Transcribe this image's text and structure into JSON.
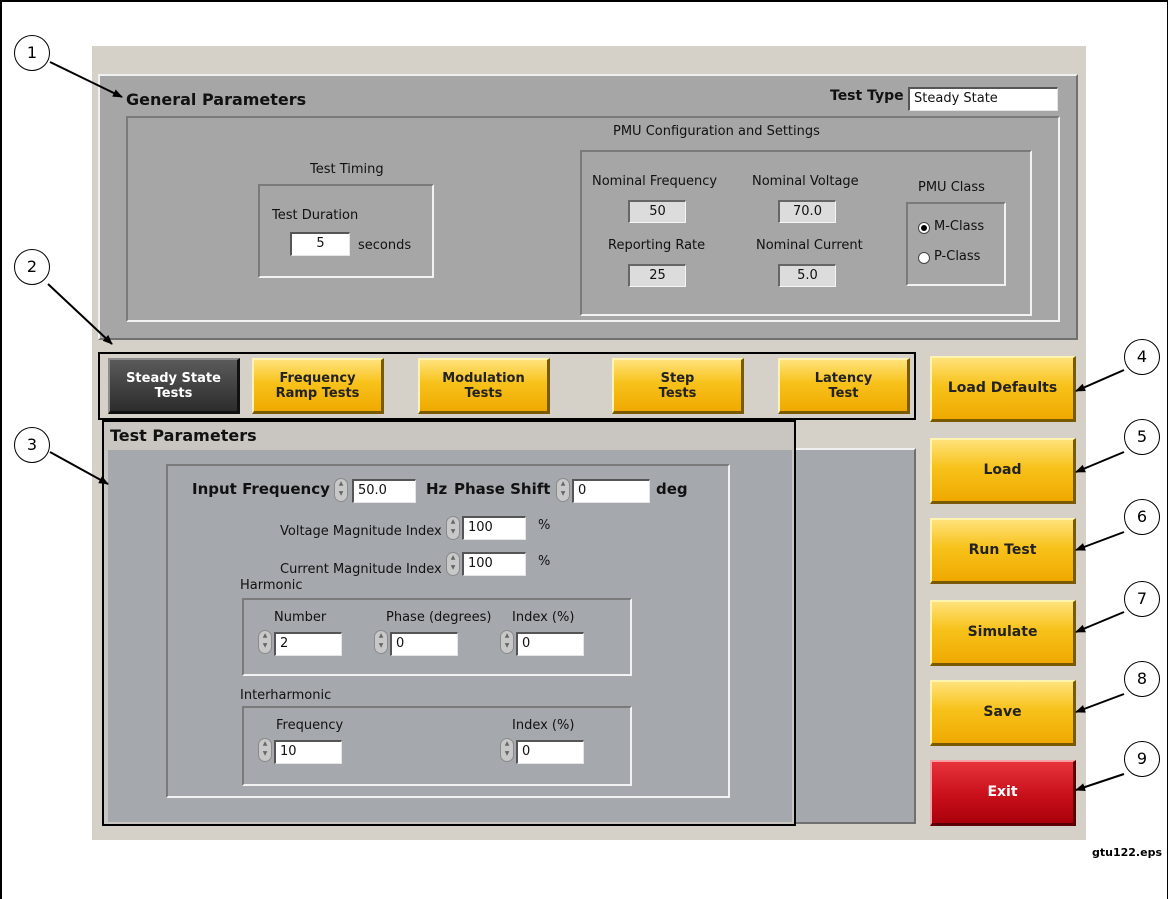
{
  "general": {
    "title": "General Parameters",
    "test_type_label": "Test Type",
    "test_type_value": "Steady State",
    "pmu_title": "PMU Configuration and Settings",
    "timing": {
      "title": "Test Timing",
      "duration_label": "Test Duration",
      "duration_value": "5",
      "duration_unit": "seconds"
    },
    "nominal_frequency": {
      "label": "Nominal Frequency",
      "value": "50"
    },
    "nominal_voltage": {
      "label": "Nominal Voltage",
      "value": "70.0"
    },
    "reporting_rate": {
      "label": "Reporting Rate",
      "value": "25"
    },
    "nominal_current": {
      "label": "Nominal Current",
      "value": "5.0"
    },
    "pmu_class": {
      "title": "PMU Class",
      "options": [
        "M-Class",
        "P-Class"
      ],
      "selected": "M-Class"
    }
  },
  "tabs": [
    {
      "line1": "Steady State",
      "line2": "Tests",
      "active": true
    },
    {
      "line1": "Frequency",
      "line2": "Ramp Tests",
      "active": false
    },
    {
      "line1": "Modulation",
      "line2": "Tests",
      "active": false
    },
    {
      "line1": "Step",
      "line2": "Tests",
      "active": false
    },
    {
      "line1": "Latency",
      "line2": "Test",
      "active": false
    }
  ],
  "test_params": {
    "title": "Test Parameters",
    "input_frequency": {
      "label": "Input Frequency",
      "value": "50.0",
      "unit": "Hz"
    },
    "phase_shift": {
      "label": "Phase Shift",
      "value": "0",
      "unit": "deg"
    },
    "voltage_magnitude": {
      "label": "Voltage Magnitude Index",
      "value": "100",
      "unit": "%"
    },
    "current_magnitude": {
      "label": "Current Magnitude Index",
      "value": "100",
      "unit": "%"
    },
    "harmonic": {
      "title": "Harmonic",
      "number": {
        "label": "Number",
        "value": "2"
      },
      "phase": {
        "label": "Phase (degrees)",
        "value": "0"
      },
      "index": {
        "label": "Index (%)",
        "value": "0"
      }
    },
    "interharmonic": {
      "title": "Interharmonic",
      "frequency": {
        "label": "Frequency",
        "value": "10"
      },
      "index": {
        "label": "Index (%)",
        "value": "0"
      }
    }
  },
  "buttons": {
    "load_defaults": "Load Defaults",
    "load": "Load",
    "run_test": "Run Test",
    "simulate": "Simulate",
    "save": "Save",
    "exit": "Exit"
  },
  "callouts": [
    "1",
    "2",
    "3",
    "4",
    "5",
    "6",
    "7",
    "8",
    "9"
  ],
  "figure_id": "gtu122.eps",
  "colors": {
    "button_yellow": "#f7c21b",
    "exit_red": "#c8101a",
    "active_tab": "#3a3a3a",
    "panel_grey": "#a6a6a6"
  }
}
